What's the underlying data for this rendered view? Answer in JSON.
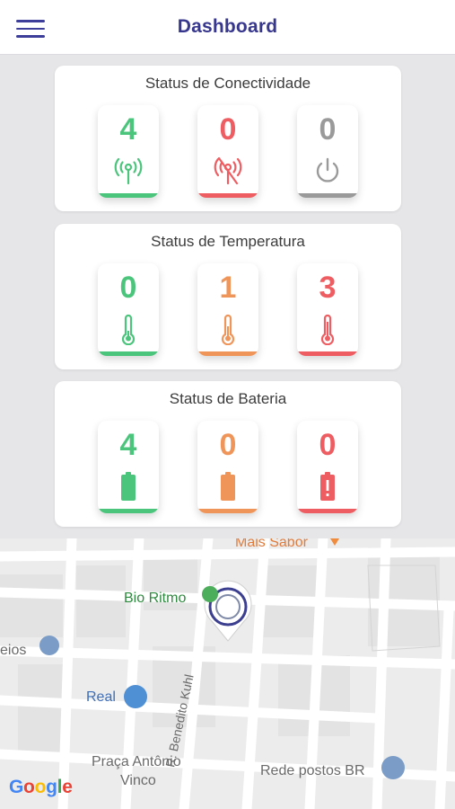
{
  "header": {
    "title": "Dashboard",
    "menu_icon": "hamburger-menu-icon"
  },
  "colors": {
    "brand": "#38378e",
    "green": "#4cc57c",
    "red": "#ee5d61",
    "gray": "#9a9a9a",
    "orange": "#f0955a"
  },
  "connectivity": {
    "title": "Status de Conectividade",
    "tiles": [
      {
        "value": "4",
        "icon": "signal-tower-icon",
        "color": "green"
      },
      {
        "value": "0",
        "icon": "signal-off-icon",
        "color": "red"
      },
      {
        "value": "0",
        "icon": "power-icon",
        "color": "gray"
      }
    ]
  },
  "temperature": {
    "title": "Status de Temperatura",
    "tiles": [
      {
        "value": "0",
        "icon": "thermometer-low-icon",
        "color": "green"
      },
      {
        "value": "1",
        "icon": "thermometer-mid-icon",
        "color": "orange"
      },
      {
        "value": "3",
        "icon": "thermometer-high-icon",
        "color": "red"
      }
    ]
  },
  "battery": {
    "title": "Status de Bateria",
    "tiles": [
      {
        "value": "4",
        "icon": "battery-full-icon",
        "color": "green"
      },
      {
        "value": "0",
        "icon": "battery-half-icon",
        "color": "orange"
      },
      {
        "value": "0",
        "icon": "battery-alert-icon",
        "color": "red"
      }
    ]
  },
  "map": {
    "labels": {
      "mais_sabor": "Mais Sabor",
      "bio_ritmo": "Bio Ritmo",
      "eios": "eios",
      "real": "Real",
      "street": "R. Benedito Kuhl",
      "praca_1": "Praça Antônio",
      "praca_2": "Vinco",
      "rede_postos": "Rede postos BR"
    },
    "google": [
      "G",
      "o",
      "o",
      "g",
      "l",
      "e"
    ]
  }
}
